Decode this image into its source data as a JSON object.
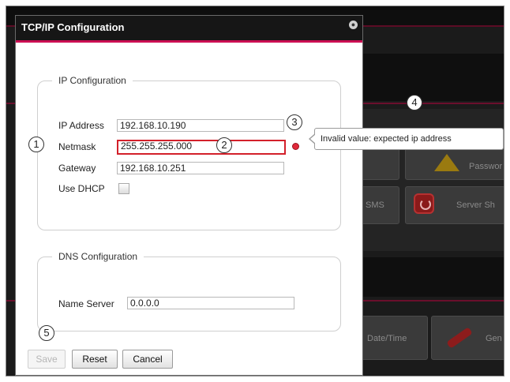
{
  "dialog": {
    "title": "TCP/IP Configuration",
    "close_glyph": "●"
  },
  "ip_config": {
    "legend": "IP Configuration",
    "ip_address_label": "IP Address",
    "ip_address_value": "192.168.10.190",
    "netmask_label": "Netmask",
    "netmask_value": "255.255.255.000",
    "gateway_label": "Gateway",
    "gateway_value": "192.168.10.251",
    "dhcp_label": "Use DHCP",
    "dhcp_checked": false
  },
  "dns_config": {
    "legend": "DNS Configuration",
    "name_server_label": "Name Server",
    "name_server_value": "0.0.0.0"
  },
  "tooltip": {
    "text": "Invalid value: expected ip address"
  },
  "buttons": {
    "save": "Save",
    "reset": "Reset",
    "cancel": "Cancel"
  },
  "callouts": {
    "c1": "1",
    "c2": "2",
    "c3": "3",
    "c4": "4",
    "c5": "5"
  },
  "background": {
    "tile_sms": "SMS",
    "tile_server": "Server Sh",
    "tile_date": "Date/Time",
    "tile_gen": "Gen",
    "tile_pass": "Passwor"
  },
  "colors": {
    "accent": "#cc0f53",
    "error": "#d3202a",
    "title_bar": "#161616"
  }
}
